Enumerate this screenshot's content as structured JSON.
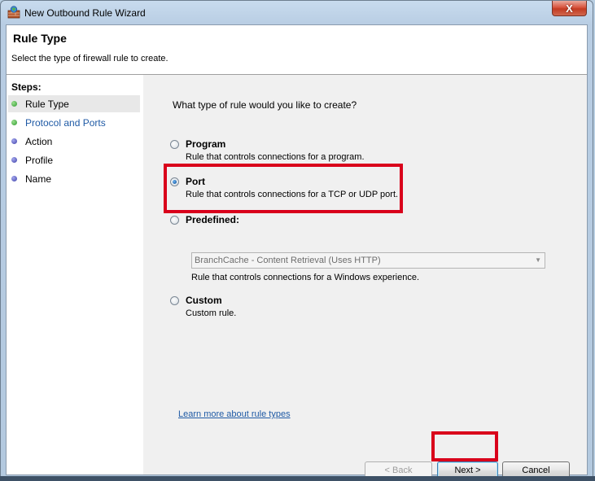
{
  "window": {
    "title": "New Outbound Rule Wizard",
    "close_label": "X"
  },
  "header": {
    "title": "Rule Type",
    "subtitle": "Select the type of firewall rule to create."
  },
  "steps": {
    "heading": "Steps:",
    "items": [
      {
        "label": "Rule Type",
        "status": "current",
        "dot_color": "#46b046"
      },
      {
        "label": "Protocol and Ports",
        "status": "next",
        "dot_color": "#46b046"
      },
      {
        "label": "Action",
        "status": "pending",
        "dot_color": "#5b5fbf"
      },
      {
        "label": "Profile",
        "status": "pending",
        "dot_color": "#5b5fbf"
      },
      {
        "label": "Name",
        "status": "pending",
        "dot_color": "#5b5fbf"
      }
    ]
  },
  "main": {
    "question": "What type of rule would you like to create?",
    "options": [
      {
        "label": "Program",
        "description": "Rule that controls connections for a program.",
        "selected": false
      },
      {
        "label": "Port",
        "description": "Rule that controls connections for a TCP or UDP port.",
        "selected": true
      },
      {
        "label": "Predefined:",
        "description": "Rule that controls connections for a Windows experience.",
        "selected": false
      },
      {
        "label": "Custom",
        "description": "Custom rule.",
        "selected": false
      }
    ],
    "predefined_combo": {
      "value": "BranchCache - Content Retrieval (Uses HTTP)",
      "enabled": false
    },
    "learn_more": "Learn more about rule types"
  },
  "buttons": {
    "back": "< Back",
    "next": "Next >",
    "cancel": "Cancel"
  },
  "colors": {
    "highlight": "#d9001b",
    "link": "#1f5aa5"
  }
}
